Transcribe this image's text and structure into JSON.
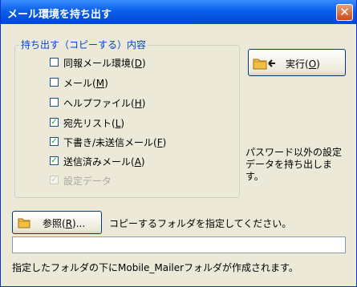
{
  "window": {
    "title": "メール環境を持ち出す",
    "close_label": "✕"
  },
  "group": {
    "legend": "持ち出す（コピーする）内容",
    "items": [
      {
        "label": "同報メール環境",
        "mnemonic": "D",
        "checked": false,
        "enabled": true
      },
      {
        "label": "メール",
        "mnemonic": "M",
        "checked": false,
        "enabled": true
      },
      {
        "label": "ヘルプファイル",
        "mnemonic": "H",
        "checked": false,
        "enabled": true
      },
      {
        "label": "宛先リスト",
        "mnemonic": "L",
        "checked": true,
        "enabled": true
      },
      {
        "label": "下書き/未送信メール",
        "mnemonic": "F",
        "checked": true,
        "enabled": true
      },
      {
        "label": "送信済みメール",
        "mnemonic": "A",
        "checked": true,
        "enabled": true
      },
      {
        "label": "設定データ",
        "mnemonic": "",
        "checked": true,
        "enabled": false
      }
    ]
  },
  "run_button": {
    "label": "実行",
    "mnemonic": "O",
    "icon": "folder-export-icon"
  },
  "note": "パスワード以外の設定データを持ち出します。",
  "browse_button": {
    "label": "参照",
    "mnemonic": "R",
    "suffix": "...",
    "icon": "folder-icon"
  },
  "hint": "コピーするフォルダを指定してください。",
  "path_field": {
    "value": ""
  },
  "footer": "指定したフォルダの下にMobile_Mailerフォルダが作成されます。",
  "colors": {
    "titlebar": "#0a5fe8",
    "accent": "#0046d5",
    "background": "#ece9d8"
  }
}
